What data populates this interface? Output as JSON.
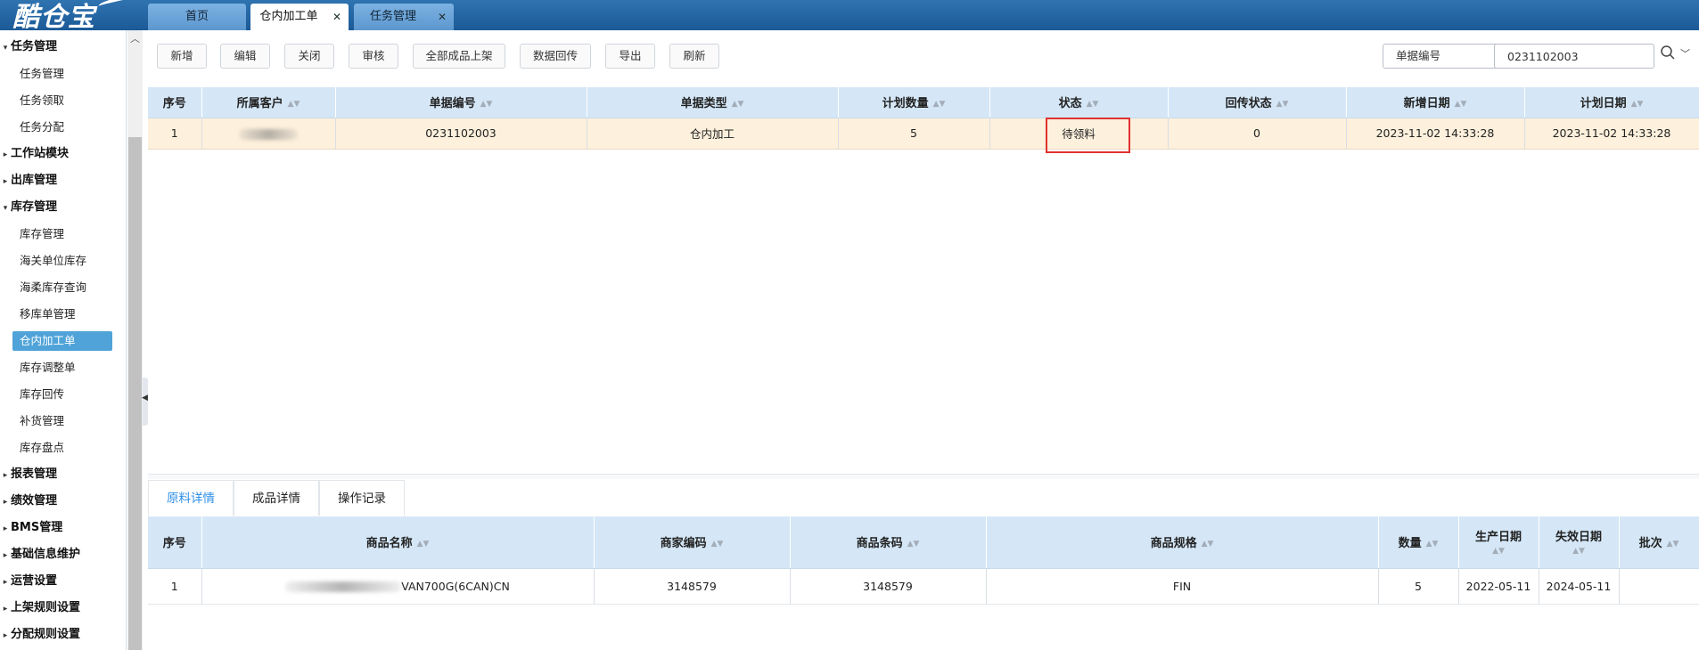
{
  "logo": {
    "text": "酷仓宝"
  },
  "tabs": [
    {
      "label": "首页",
      "active": false,
      "closable": false
    },
    {
      "label": "仓内加工单",
      "active": true,
      "closable": true
    },
    {
      "label": "任务管理",
      "active": false,
      "closable": true
    }
  ],
  "sidebar": {
    "items": [
      {
        "label": "任务管理",
        "kind": "group",
        "expanded": true
      },
      {
        "label": "任务管理",
        "kind": "sub"
      },
      {
        "label": "任务领取",
        "kind": "sub"
      },
      {
        "label": "任务分配",
        "kind": "sub"
      },
      {
        "label": "工作站模块",
        "kind": "group",
        "expanded": false
      },
      {
        "label": "出库管理",
        "kind": "group",
        "expanded": false
      },
      {
        "label": "库存管理",
        "kind": "group",
        "expanded": true
      },
      {
        "label": "库存管理",
        "kind": "sub"
      },
      {
        "label": "海关单位库存",
        "kind": "sub"
      },
      {
        "label": "海柔库存查询",
        "kind": "sub"
      },
      {
        "label": "移库单管理",
        "kind": "sub"
      },
      {
        "label": "仓内加工单",
        "kind": "sub",
        "selected": true
      },
      {
        "label": "库存调整单",
        "kind": "sub"
      },
      {
        "label": "库存回传",
        "kind": "sub"
      },
      {
        "label": "补货管理",
        "kind": "sub"
      },
      {
        "label": "库存盘点",
        "kind": "sub"
      },
      {
        "label": "报表管理",
        "kind": "group",
        "expanded": false
      },
      {
        "label": "绩效管理",
        "kind": "group",
        "expanded": false
      },
      {
        "label": "BMS管理",
        "kind": "group",
        "expanded": false
      },
      {
        "label": "基础信息维护",
        "kind": "group",
        "expanded": false
      },
      {
        "label": "运营设置",
        "kind": "group",
        "expanded": false
      },
      {
        "label": "上架规则设置",
        "kind": "group",
        "expanded": false
      },
      {
        "label": "分配规则设置",
        "kind": "group",
        "expanded": false
      }
    ]
  },
  "toolbar": {
    "buttons": [
      "新增",
      "编辑",
      "关闭",
      "审核",
      "全部成品上架",
      "数据回传",
      "导出",
      "刷新"
    ]
  },
  "search": {
    "field_select": "单据编号",
    "value": "0231102003"
  },
  "main_table": {
    "columns": [
      "序号",
      "所属客户",
      "单据编号",
      "单据类型",
      "计划数量",
      "状态",
      "回传状态",
      "新增日期",
      "计划日期"
    ],
    "rows": [
      {
        "index": "1",
        "customer": "",
        "doc_no": "0231102003",
        "doc_type": "仓内加工",
        "plan_qty": "5",
        "status": "待领料",
        "callback_status": "0",
        "created": "2023-11-02 14:33:28",
        "planned": "2023-11-02 14:33:28"
      }
    ]
  },
  "detail_tabs": [
    "原料详情",
    "成品详情",
    "操作记录"
  ],
  "detail_table": {
    "columns": [
      "序号",
      "商品名称",
      "商家编码",
      "商品条码",
      "商品规格",
      "数量",
      "生产日期",
      "失效日期",
      "批次"
    ],
    "rows": [
      {
        "index": "1",
        "name_visible": "VAN700G(6CAN)CN",
        "merchant_code": "3148579",
        "barcode": "3148579",
        "spec": "FIN",
        "qty": "5",
        "mfg_date": "2022-05-11",
        "exp_date": "2024-05-11",
        "batch": ""
      }
    ]
  },
  "colors": {
    "topbar": "#1f5f9c",
    "tab_inactive": "#6aa4da",
    "sidebar_selected": "#4fa3d8",
    "row_highlight": "#fdf0dc",
    "header_bg": "#d5e7f7",
    "active_detail_tab": "#2c8ee8",
    "annotation_box": "#e0312f"
  }
}
